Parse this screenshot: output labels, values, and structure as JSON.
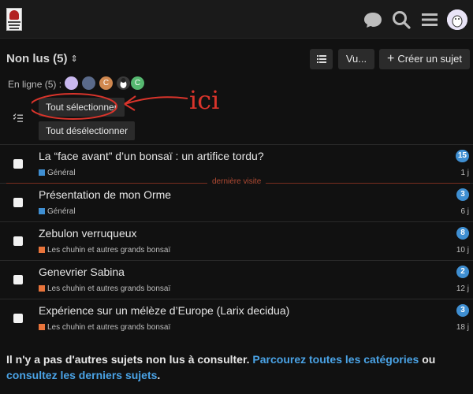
{
  "header": {
    "logo_name": "bonsai-logo",
    "icons": [
      "chat-icon",
      "search-icon",
      "hamburger-menu-icon",
      "user-avatar"
    ]
  },
  "nav": {
    "filter_label": "Non lus (5)",
    "chevron": "⌃⌄",
    "view_label": "Vu...",
    "create_label": "Créer un sujet",
    "create_icon": "+"
  },
  "online": {
    "label": "En ligne (5) :",
    "users": [
      {
        "initial": "",
        "color": "#c9b8ef"
      },
      {
        "initial": "",
        "color": "#5a6a8a"
      },
      {
        "initial": "C",
        "color": "#d0884f"
      },
      {
        "initial": "",
        "color": "#3a3a3a"
      },
      {
        "initial": "C",
        "color": "#56b870"
      }
    ]
  },
  "bulk": {
    "select_all": "Tout sélectionner",
    "deselect_all": "Tout désélectionner",
    "annotation_text": "ici"
  },
  "topics": [
    {
      "title": "La “face avant” d’un bonsaï : un artifice tordu?",
      "category": "Général",
      "category_color": "#3f8fd2",
      "unread": "15",
      "age": "1 j"
    },
    {
      "title": "Présentation de mon Orme",
      "category": "Général",
      "category_color": "#3f8fd2",
      "unread": "3",
      "age": "6 j"
    },
    {
      "title": "Zebulon verruqueux",
      "category": "Les chuhin et autres grands bonsaï",
      "category_color": "#e8743b",
      "unread": "8",
      "age": "10 j"
    },
    {
      "title": "Genevrier Sabina",
      "category": "Les chuhin et autres grands bonsaï",
      "category_color": "#e8743b",
      "unread": "2",
      "age": "12 j"
    },
    {
      "title": "Expérience sur un mélèze d’Europe (Larix decidua)",
      "category": "Les chuhin et autres grands bonsaï",
      "category_color": "#e8743b",
      "unread": "3",
      "age": "18 j"
    }
  ],
  "last_visit_label": "dernière visite",
  "footer": {
    "text_before": "Il n'y a pas d'autres sujets non lus à consulter.",
    "link1": "Parcourez toutes les catégories",
    "text_middle": "ou",
    "link2": "consultez les derniers sujets",
    "text_after": "."
  },
  "colors": {
    "accent": "#3f8fd2",
    "annotation": "#d9342b",
    "background": "#111111"
  }
}
